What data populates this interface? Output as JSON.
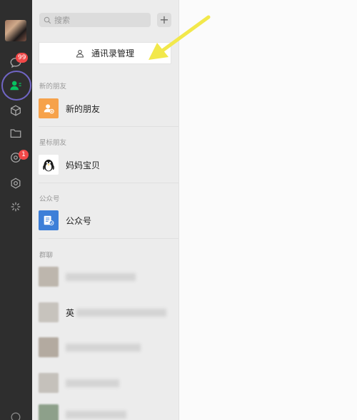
{
  "rail": {
    "chat_badge": "99",
    "settings_badge": "1",
    "icons": [
      "chat-icon",
      "contacts-icon",
      "favorites-icon",
      "files-icon",
      "moments-icon",
      "miniprogram-icon",
      "channels-icon",
      "phone-icon"
    ]
  },
  "search": {
    "placeholder": "搜索"
  },
  "header": {
    "add_label": "+"
  },
  "manage_button": {
    "label": "通讯录管理"
  },
  "sections": {
    "new_friends_title": "新的朋友",
    "starred_title": "星标朋友",
    "official_title": "公众号",
    "groups_title": "群聊"
  },
  "items": {
    "new_friends": "新的朋友",
    "starred_contact": "妈妈宝贝",
    "official_accounts": "公众号"
  },
  "groups": {
    "visible_fragment": "英"
  },
  "colors": {
    "rail_bg": "#2e2e2e",
    "badge": "#f04848",
    "contacts_active": "#07c160",
    "annotation_circle": "#7065c4",
    "annotation_arrow": "#f2e84b",
    "new_friends_icon": "#f6a24b",
    "official_icon": "#3d7fd8"
  }
}
